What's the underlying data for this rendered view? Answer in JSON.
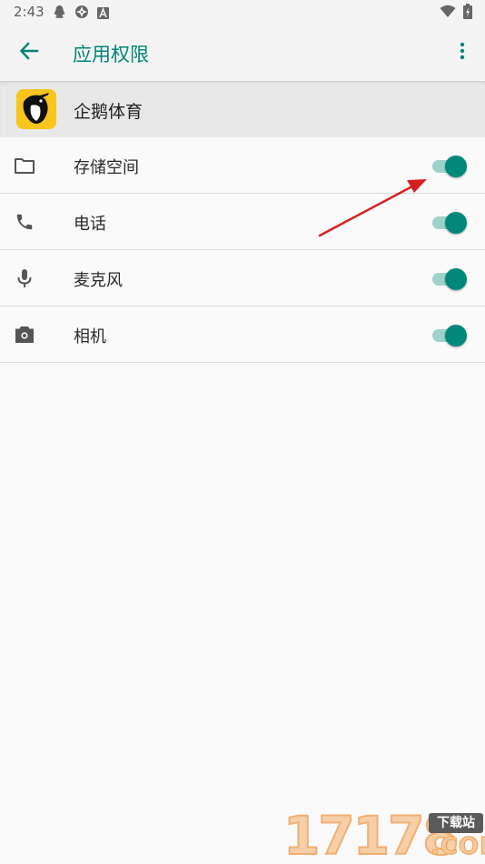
{
  "status_bar": {
    "time": "2:43",
    "icons_left": [
      "qq-icon",
      "sync-icon",
      "a-notification-icon"
    ],
    "icons_right": [
      "wifi-icon",
      "battery-icon"
    ]
  },
  "app_bar": {
    "title": "应用权限",
    "back_icon": "arrow-back-icon",
    "menu_icon": "more-vert-icon"
  },
  "app_header": {
    "app_name": "企鹅体育"
  },
  "permissions": [
    {
      "label": "存储空间",
      "icon": "folder-icon",
      "enabled": true
    },
    {
      "label": "电话",
      "icon": "phone-icon",
      "enabled": true
    },
    {
      "label": "麦克风",
      "icon": "microphone-icon",
      "enabled": true
    },
    {
      "label": "相机",
      "icon": "camera-icon",
      "enabled": true
    }
  ],
  "watermark": {
    "digits": "17178",
    "tag": "下载站",
    "suffix": ".COM"
  },
  "colors": {
    "accent": "#008577",
    "switch_thumb": "#00897b",
    "switch_track": "#9fd1cb",
    "app_icon_bg": "#f8c51c",
    "annotation_arrow": "#d42020"
  }
}
